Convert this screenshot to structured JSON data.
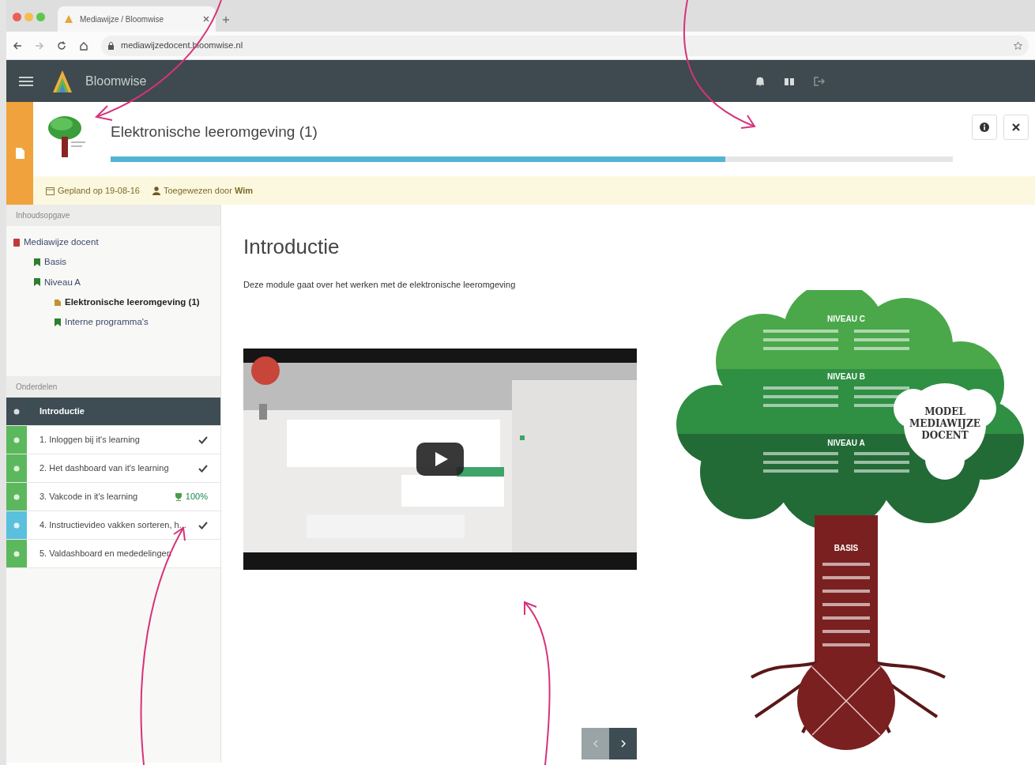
{
  "browser": {
    "tab_title": "Mediawijze / Bloomwise",
    "url": "mediawijzedocent.bloomwise.nl"
  },
  "navbar": {
    "brand": "Bloomwise"
  },
  "module": {
    "title": "Elektronische leeromgeving (1)",
    "progress": {
      "level": 0.73
    },
    "planned": "Gepland op 19-08-16",
    "assigned": "Toegewezen door **Wim**"
  },
  "toc": {
    "heading": "Inhoudsopgave",
    "items": [
      {
        "label": "Mediawijze docent",
        "kind": "course",
        "selected": false,
        "children": [
          {
            "label": "Basis",
            "kind": "level",
            "selected": false
          },
          {
            "label": "Niveau A",
            "kind": "level",
            "selected": false,
            "children": [
              {
                "label": "Elektronische leeromgeving (1)",
                "kind": "module",
                "selected": true
              },
              {
                "label": "Interne programma's",
                "kind": "level",
                "selected": false
              }
            ]
          }
        ]
      }
    ]
  },
  "parts": {
    "heading": "Onderdelen",
    "items": [
      {
        "label": "Introductie",
        "selected": true,
        "color": "#3e4c53",
        "completed": false
      },
      {
        "label": "1. Inloggen bij it's learning",
        "selected": false,
        "color": "#5cb85c",
        "completed": true
      },
      {
        "label": "2. Het dashboard van it's learning",
        "selected": false,
        "color": "#5cb85c",
        "completed": true
      },
      {
        "label": "3. Vakcode in it's learning",
        "selected": false,
        "color": "#5cb85c",
        "completed": false,
        "score": "100%"
      },
      {
        "label": "4. Instructievideo vakken sorteren, h...",
        "selected": false,
        "color": "#5bc0de",
        "completed": true
      },
      {
        "label": "5. Valdashboard en mededelingen",
        "selected": false,
        "color": "#5cb85c",
        "completed": false
      }
    ]
  },
  "content": {
    "heading": "Introductie",
    "text": "Deze module gaat over het werken met de elektronische leeromgeving"
  },
  "diagram": {
    "levels": [
      "NIVEAU C",
      "NIVEAU B",
      "NIVEAU A"
    ],
    "badge": "MODEL MEDIAWIJZE DOCENT",
    "trunk": "BASIS"
  },
  "pager": {
    "previous": {
      "disabled": true
    },
    "next": {
      "disabled": false
    }
  }
}
